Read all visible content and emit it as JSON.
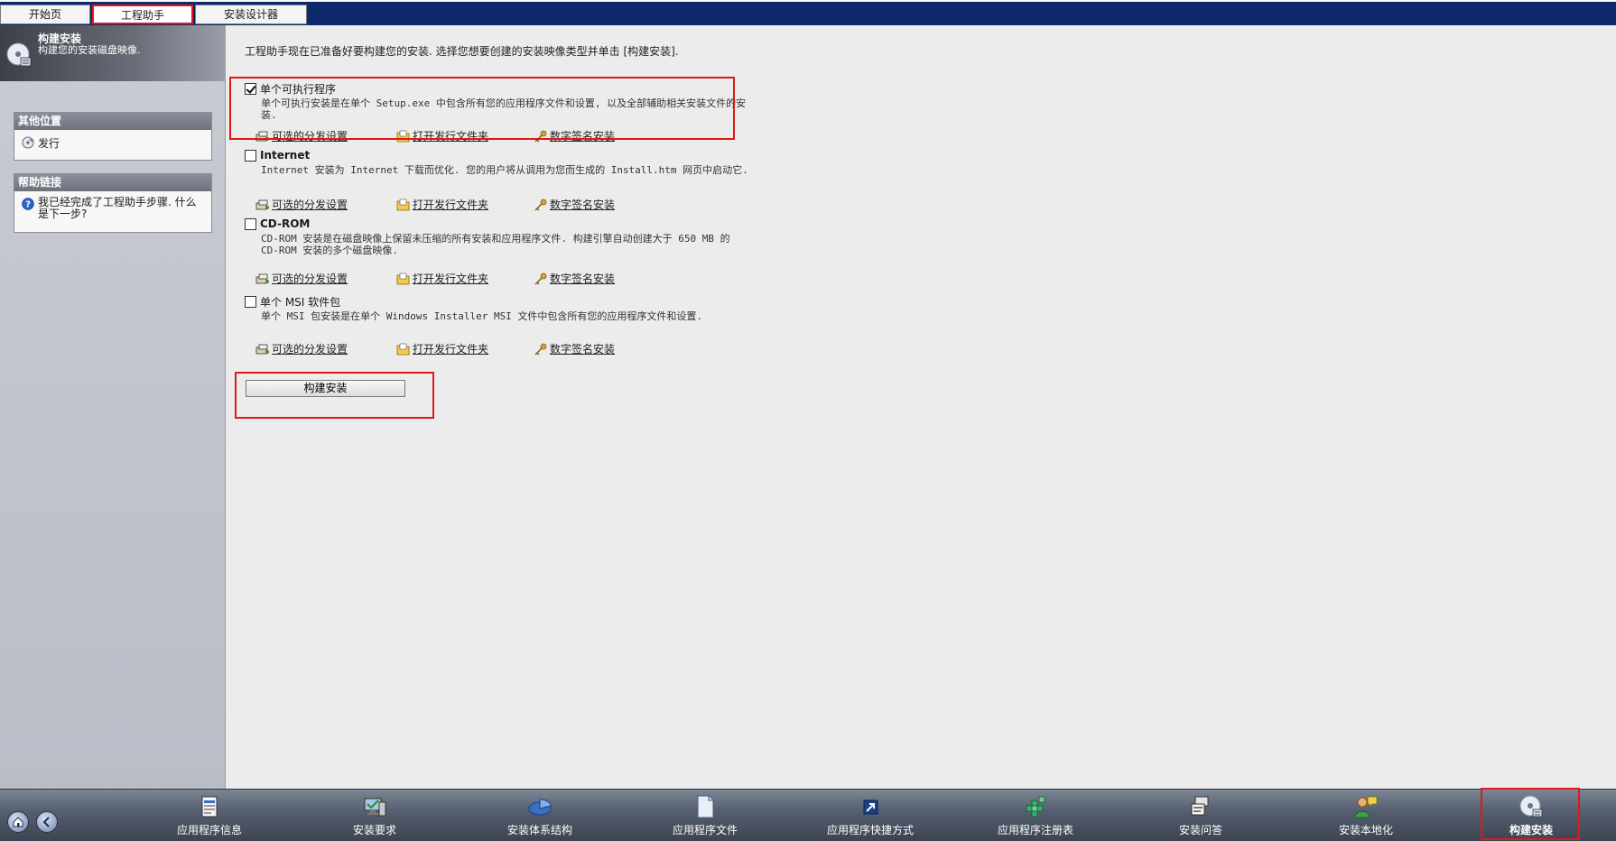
{
  "tabs": [
    {
      "label": "开始页",
      "active": false
    },
    {
      "label": "工程助手",
      "active": true
    },
    {
      "label": "安装设计器",
      "active": false
    }
  ],
  "sidebar": {
    "title": "构建安装",
    "subtitle": "构建您的安装磁盘映像.",
    "other_locations": {
      "heading": "其他位置",
      "items": [
        {
          "label": "发行",
          "icon": "release-icon"
        }
      ]
    },
    "help_links": {
      "heading": "帮助链接",
      "items": [
        {
          "label": "我已经完成了工程助手步骤. 什么是下一步?",
          "icon": "help-icon"
        }
      ]
    }
  },
  "main": {
    "intro": "工程助手现在已准备好要构建您的安装. 选择您想要创建的安装映像类型并单击 [构建安装].",
    "options": [
      {
        "title": "单个可执行程序",
        "checked": true,
        "description": "单个可执行安装是在单个 Setup.exe 中包含所有您的应用程序文件和设置, 以及全部辅助相关安装文件的安装."
      },
      {
        "title": "Internet",
        "checked": false,
        "description": "Internet 安装为 Internet 下载而优化. 您的用户将从调用为您而生成的 Install.htm 网页中启动它."
      },
      {
        "title": "CD-ROM",
        "checked": false,
        "description": "CD-ROM 安装是在磁盘映像上保留未压缩的所有安装和应用程序文件. 构建引擎自动创建大于 650 MB 的 CD-ROM 安装的多个磁盘映像."
      },
      {
        "title": "单个 MSI 软件包",
        "checked": false,
        "description": "单个 MSI 包安装是在单个 Windows Installer MSI 文件中包含所有您的应用程序文件和设置."
      }
    ],
    "links": {
      "distribution": "可选的分发设置",
      "open_folder": "打开发行文件夹",
      "sign": "数字签名安装"
    },
    "build_button": "构建安装"
  },
  "bottom": {
    "steps": [
      {
        "label": "应用程序信息",
        "icon": "app-info-icon"
      },
      {
        "label": "安装要求",
        "icon": "requirements-icon"
      },
      {
        "label": "安装体系结构",
        "icon": "architecture-icon"
      },
      {
        "label": "应用程序文件",
        "icon": "app-files-icon"
      },
      {
        "label": "应用程序快捷方式",
        "icon": "shortcut-icon"
      },
      {
        "label": "应用程序注册表",
        "icon": "registry-icon"
      },
      {
        "label": "安装问答",
        "icon": "interview-icon"
      },
      {
        "label": "安装本地化",
        "icon": "localization-icon"
      },
      {
        "label": "构建安装",
        "icon": "build-disc-icon",
        "current": true
      }
    ]
  }
}
